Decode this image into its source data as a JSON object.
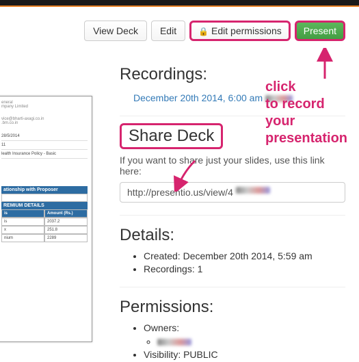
{
  "toolbar": {
    "view_deck": "View Deck",
    "edit": "Edit",
    "edit_permissions": "Edit permissions",
    "present": "Present"
  },
  "sections": {
    "recordings_title": "Recordings:",
    "recording_link": "December 20th 2014, 6:00 am",
    "share_title": "Share Deck",
    "share_helper": "If you want to share just your slides, use this link here:",
    "share_url": "http://presentio.us/view/4",
    "details_title": "Details:",
    "details_created": "Created: December 20th 2014, 5:59 am",
    "details_recordings": "Recordings: 1",
    "permissions_title": "Permissions:",
    "permissions_owners": "Owners:",
    "permissions_visibility": "Visibility: PUBLIC"
  },
  "annotation": {
    "l1": "click",
    "l2": "to record",
    "l3": "your",
    "l4": "presentation"
  },
  "thumb": {
    "date": "28/5/2014",
    "row1": "11",
    "row2": "lealth Insurance Policy - Basic",
    "rel": "ationship with Proposer",
    "prem": "REMIUM DETAILS",
    "amt": "Amount (Rs.)",
    "v1": "2037.2",
    "v2": "251.8",
    "v3": "2289",
    "c1": "is",
    "c2": "x",
    "c3": "nium"
  }
}
